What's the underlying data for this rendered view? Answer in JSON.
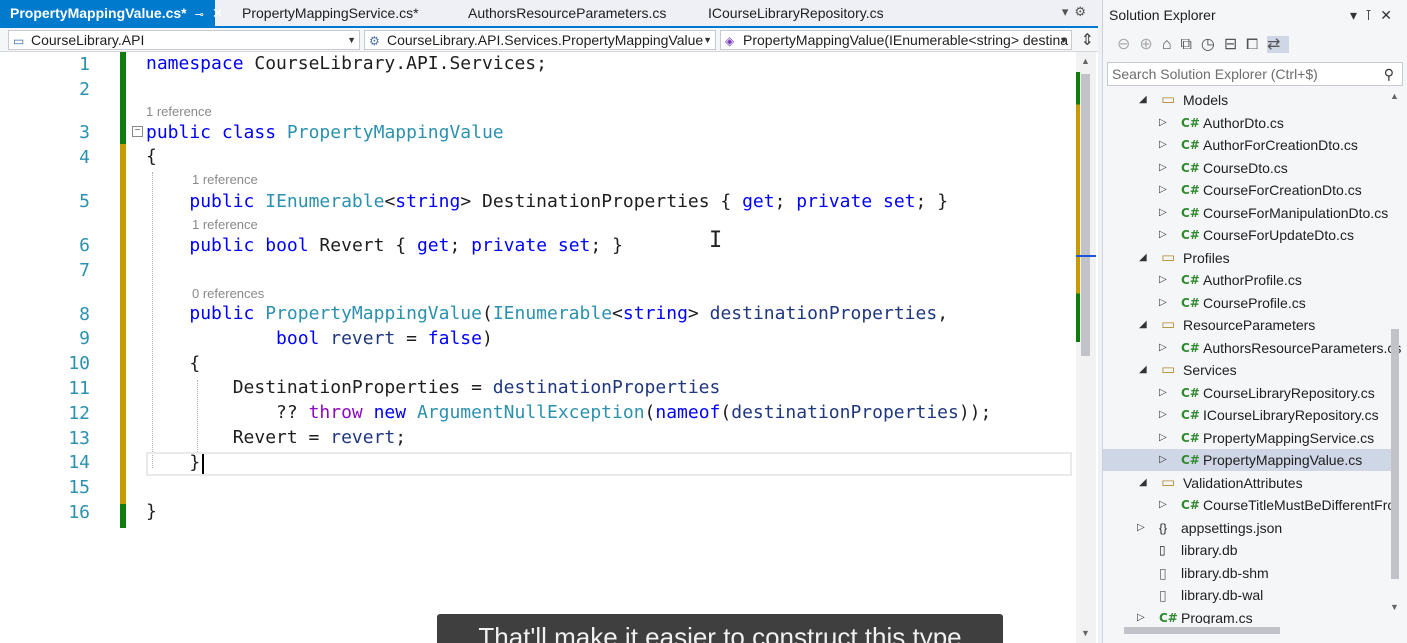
{
  "tabs": [
    {
      "label": "PropertyMappingValue.cs*",
      "active": true
    },
    {
      "label": "PropertyMappingService.cs*",
      "active": false
    },
    {
      "label": "AuthorsResourceParameters.cs",
      "active": false
    },
    {
      "label": "ICourseLibraryRepository.cs",
      "active": false
    }
  ],
  "nav": {
    "project": "CourseLibrary.API",
    "type": "CourseLibrary.API.Services.PropertyMappingValue",
    "member": "PropertyMappingValue(IEnumerable<string> destina"
  },
  "code": {
    "line_numbers": [
      "1",
      "2",
      "3",
      "4",
      "5",
      "6",
      "7",
      "8",
      "9",
      "10",
      "11",
      "12",
      "13",
      "14",
      "15",
      "16"
    ],
    "lens": {
      "class": "1 reference",
      "dest": "1 reference",
      "revert": "1 reference",
      "ctor": "0 references"
    }
  },
  "subtitle": "That'll make it easier to construct this type",
  "solution_explorer": {
    "title": "Solution Explorer",
    "search_placeholder": "Search Solution Explorer (Ctrl+$)",
    "items": [
      {
        "label": "Models",
        "kind": "folder",
        "depth": 1,
        "expanded": true
      },
      {
        "label": "AuthorDto.cs",
        "kind": "cs",
        "depth": 2
      },
      {
        "label": "AuthorForCreationDto.cs",
        "kind": "cs",
        "depth": 2
      },
      {
        "label": "CourseDto.cs",
        "kind": "cs",
        "depth": 2
      },
      {
        "label": "CourseForCreationDto.cs",
        "kind": "cs",
        "depth": 2
      },
      {
        "label": "CourseForManipulationDto.cs",
        "kind": "cs",
        "depth": 2
      },
      {
        "label": "CourseForUpdateDto.cs",
        "kind": "cs",
        "depth": 2
      },
      {
        "label": "Profiles",
        "kind": "folder",
        "depth": 1,
        "expanded": true
      },
      {
        "label": "AuthorProfile.cs",
        "kind": "cs",
        "depth": 2
      },
      {
        "label": "CourseProfile.cs",
        "kind": "cs",
        "depth": 2
      },
      {
        "label": "ResourceParameters",
        "kind": "folder",
        "depth": 1,
        "expanded": true
      },
      {
        "label": "AuthorsResourceParameters.cs",
        "kind": "cs",
        "depth": 2
      },
      {
        "label": "Services",
        "kind": "folder",
        "depth": 1,
        "expanded": true
      },
      {
        "label": "CourseLibraryRepository.cs",
        "kind": "cs",
        "depth": 2
      },
      {
        "label": "ICourseLibraryRepository.cs",
        "kind": "cs",
        "depth": 2
      },
      {
        "label": "PropertyMappingService.cs",
        "kind": "cs",
        "depth": 2
      },
      {
        "label": "PropertyMappingValue.cs",
        "kind": "cs",
        "depth": 2,
        "selected": true
      },
      {
        "label": "ValidationAttributes",
        "kind": "folder",
        "depth": 1,
        "expanded": true
      },
      {
        "label": "CourseTitleMustBeDifferentFro",
        "kind": "cs",
        "depth": 2
      },
      {
        "label": "appsettings.json",
        "kind": "json",
        "depth": 1
      },
      {
        "label": "library.db",
        "kind": "db",
        "depth": 1
      },
      {
        "label": "library.db-shm",
        "kind": "file",
        "depth": 1
      },
      {
        "label": "library.db-wal",
        "kind": "file",
        "depth": 1
      },
      {
        "label": "Program.cs",
        "kind": "cs",
        "depth": 1
      }
    ]
  }
}
